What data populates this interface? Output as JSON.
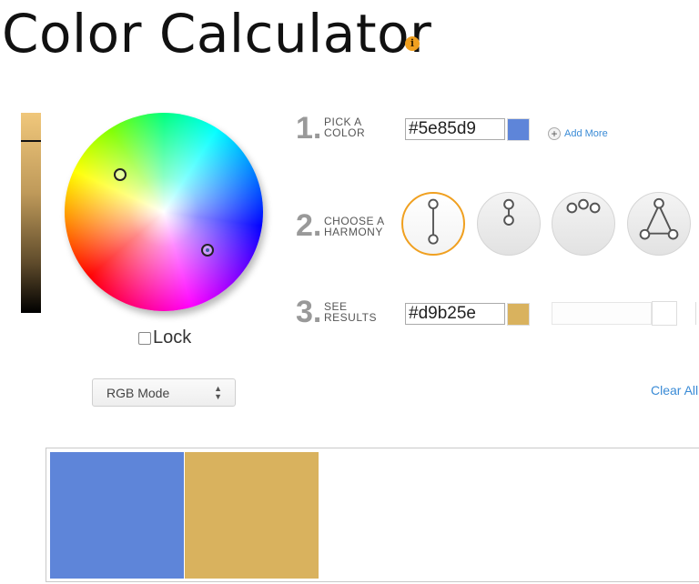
{
  "page": {
    "title": "Color Calculator"
  },
  "info": {
    "icon": "info-icon",
    "glyph": "i"
  },
  "lock": {
    "label": "Lock",
    "checked": false
  },
  "mode": {
    "selected": "RGB Mode"
  },
  "steps": [
    {
      "num": "1.",
      "line1": "PICK A",
      "line2": "COLOR"
    },
    {
      "num": "2.",
      "line1": "CHOOSE A",
      "line2": "HARMONY"
    },
    {
      "num": "3.",
      "line1": "SEE",
      "line2": "RESULTS"
    }
  ],
  "pick": {
    "hex": "#5e85d9",
    "swatch_color": "#5e85d9"
  },
  "add_more": {
    "label": "Add More"
  },
  "harmonies": [
    {
      "name": "complementary",
      "active": true
    },
    {
      "name": "monochromatic",
      "active": false
    },
    {
      "name": "analogous",
      "active": false
    },
    {
      "name": "triad",
      "active": false
    }
  ],
  "result": {
    "hex": "#d9b25e",
    "swatch_color": "#d9b25e"
  },
  "clear_all": {
    "label": "Clear All"
  },
  "palette": {
    "colors": [
      "#5e85d9",
      "#d9b25e"
    ]
  },
  "colors": {
    "accent": "#f0a020",
    "link": "#3a8bd6"
  }
}
